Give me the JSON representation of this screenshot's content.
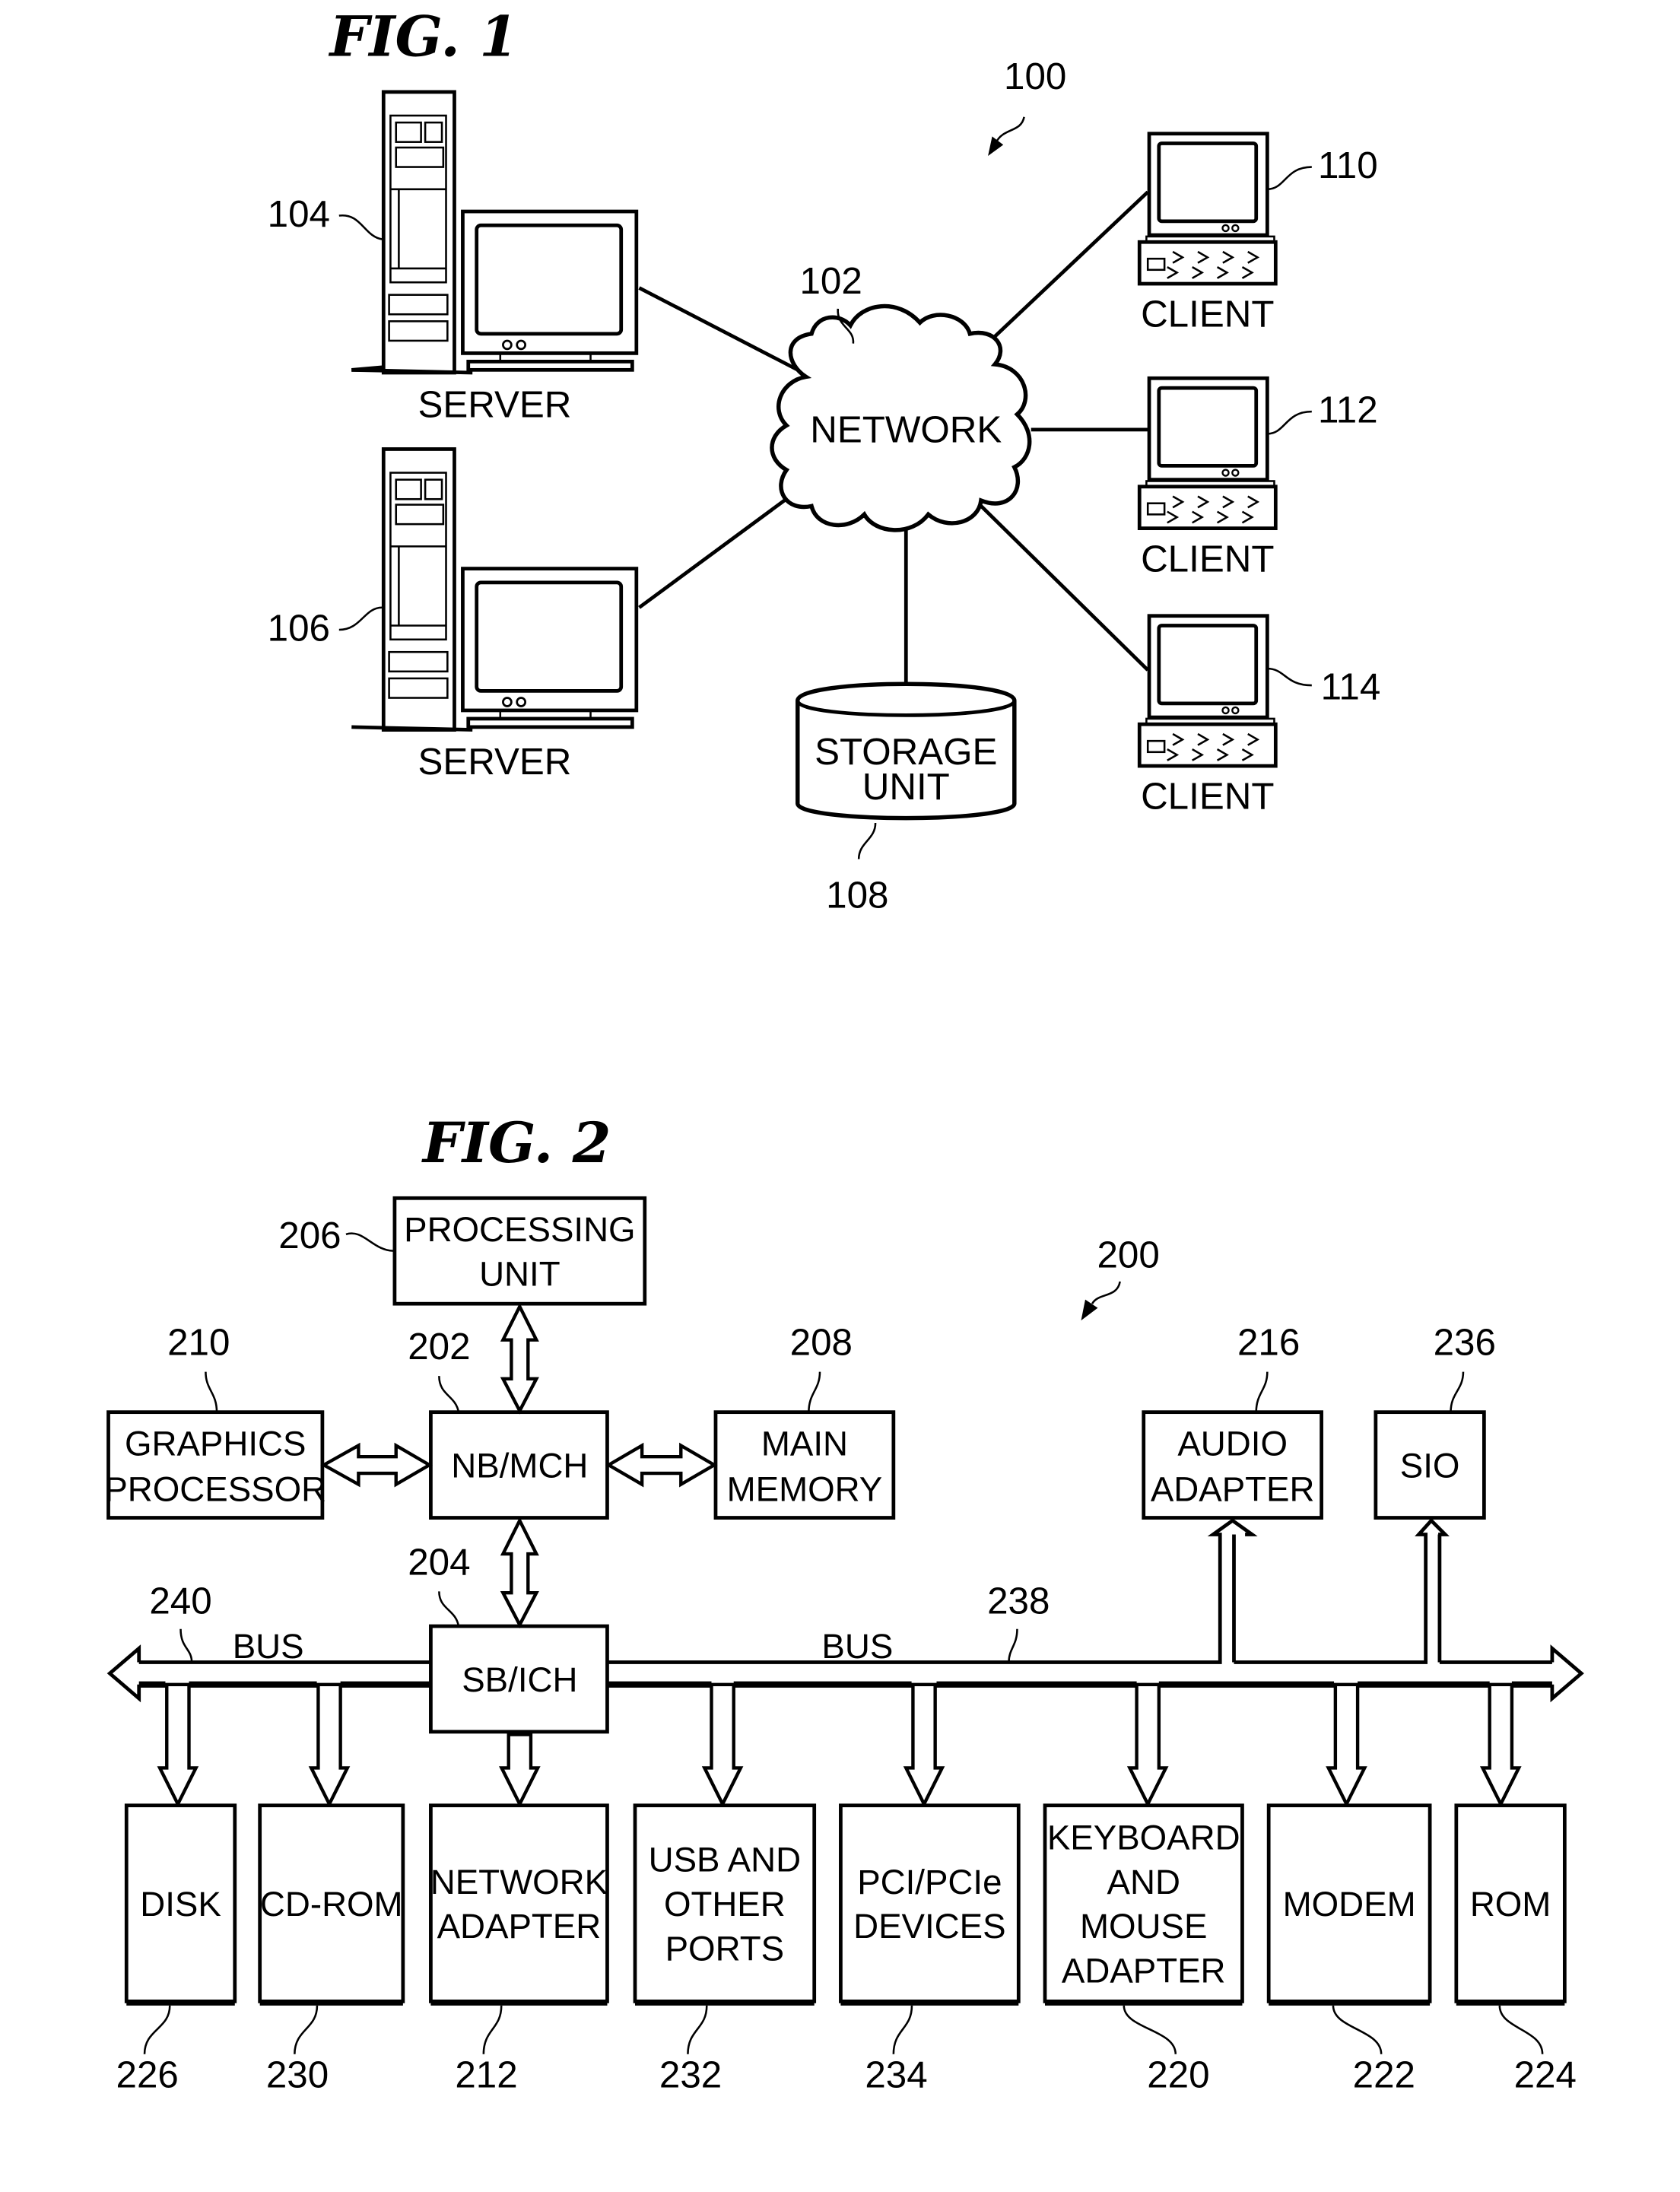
{
  "fig1": {
    "title": "FIG. 1",
    "system_ref": "100",
    "network": {
      "ref": "102",
      "label": "NETWORK"
    },
    "servers": [
      {
        "ref": "104",
        "label": "SERVER"
      },
      {
        "ref": "106",
        "label": "SERVER"
      }
    ],
    "storage": {
      "ref": "108",
      "label_line1": "STORAGE",
      "label_line2": "UNIT"
    },
    "clients": [
      {
        "ref": "110",
        "label": "CLIENT"
      },
      {
        "ref": "112",
        "label": "CLIENT"
      },
      {
        "ref": "114",
        "label": "CLIENT"
      }
    ]
  },
  "fig2": {
    "title": "FIG. 2",
    "system_ref": "200",
    "processing_unit": {
      "ref": "206",
      "line1": "PROCESSING",
      "line2": "UNIT"
    },
    "nb_mch": {
      "ref": "202",
      "label": "NB/MCH"
    },
    "graphics": {
      "ref": "210",
      "line1": "GRAPHICS",
      "line2": "PROCESSOR"
    },
    "main_memory": {
      "ref": "208",
      "line1": "MAIN",
      "line2": "MEMORY"
    },
    "audio": {
      "ref": "216",
      "line1": "AUDIO",
      "line2": "ADAPTER"
    },
    "sio": {
      "ref": "236",
      "label": "SIO"
    },
    "sb_ich": {
      "ref": "204",
      "label": "SB/ICH"
    },
    "bus_left": {
      "ref": "240",
      "label": "BUS"
    },
    "bus_right": {
      "ref": "238",
      "label": "BUS"
    },
    "devices": [
      {
        "ref": "226",
        "lines": [
          "DISK"
        ]
      },
      {
        "ref": "230",
        "lines": [
          "CD-ROM"
        ]
      },
      {
        "ref": "212",
        "lines": [
          "NETWORK",
          "ADAPTER"
        ]
      },
      {
        "ref": "232",
        "lines": [
          "USB AND",
          "OTHER",
          "PORTS"
        ]
      },
      {
        "ref": "234",
        "lines": [
          "PCI/PCIe",
          "DEVICES"
        ]
      },
      {
        "ref": "220",
        "lines": [
          "KEYBOARD",
          "AND",
          "MOUSE",
          "ADAPTER"
        ]
      },
      {
        "ref": "222",
        "lines": [
          "MODEM"
        ]
      },
      {
        "ref": "224",
        "lines": [
          "ROM"
        ]
      }
    ]
  }
}
